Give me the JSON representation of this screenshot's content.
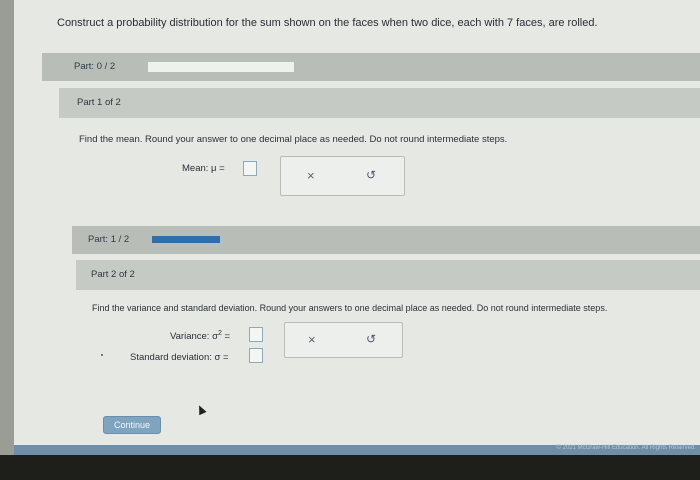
{
  "question": {
    "text": "Construct a probability distribution for the sum shown on the faces when two dice, each with 7 faces, are rolled."
  },
  "part_progress_top": {
    "label": "Part: 0 / 2",
    "completed": 0,
    "total": 2
  },
  "part1": {
    "header": "Part 1 of 2",
    "instruction": "Find the mean. Round your answer to one decimal place as needed. Do not round intermediate steps.",
    "mean_label": "Mean: μ =",
    "mean_value": ""
  },
  "part_progress_mid": {
    "label": "Part: 1 / 2",
    "completed": 1,
    "total": 2
  },
  "part2": {
    "header": "Part 2 of 2",
    "instruction": "Find the variance and standard deviation. Round your answers to one decimal place as needed. Do not round intermediate steps.",
    "variance_label": "Variance: σ",
    "variance_sup": "2",
    "variance_eq": "=",
    "stddev_label": "Standard deviation: σ =",
    "variance_value": "",
    "stddev_value": ""
  },
  "actions": {
    "clear_symbol": "×",
    "undo_symbol": "↺"
  },
  "continue_label": "Continue",
  "footer": {
    "copyright": "© 2021 McGraw-Hill Education. All Rights Reserved."
  },
  "colors": {
    "accent": "#2f6ea8",
    "button": "#7fa4bf",
    "bar": "#b9bdb8"
  }
}
